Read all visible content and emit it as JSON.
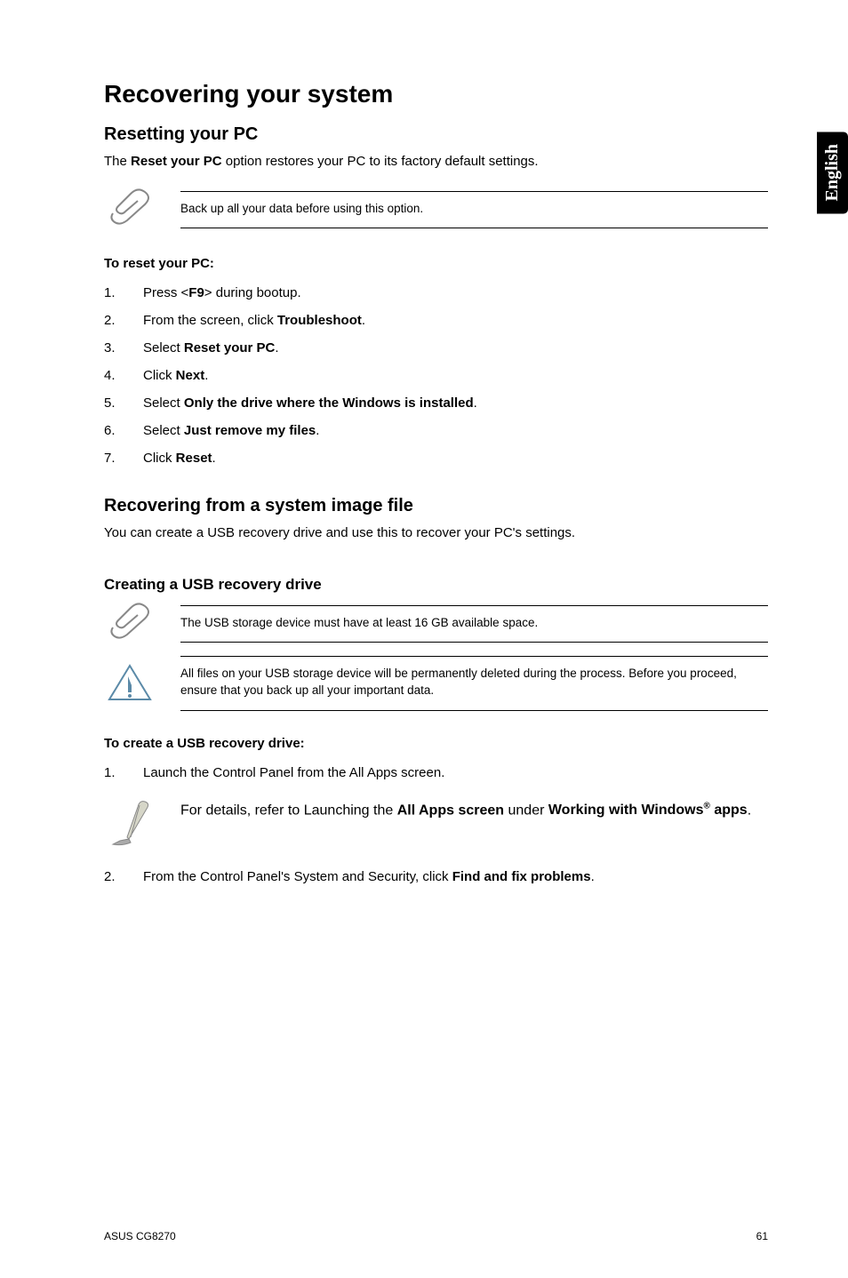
{
  "language_tab": "English",
  "h1": "Recovering your system",
  "reset": {
    "heading": "Resetting your PC",
    "intro_pre": "The ",
    "intro_bold": "Reset your PC",
    "intro_post": " option restores your PC to its factory default settings.",
    "note": "Back up all your data before using this option.",
    "steps_heading": "To reset your PC:",
    "step1_pre": "Press <",
    "step1_bold": "F9",
    "step1_post": "> during bootup.",
    "step2_pre": "From the screen, click ",
    "step2_bold": "Troubleshoot",
    "step2_post": ".",
    "step3_pre": "Select ",
    "step3_bold": "Reset your PC",
    "step3_post": ".",
    "step4_pre": "Click ",
    "step4_bold": "Next",
    "step4_post": ".",
    "step5_pre": "Select ",
    "step5_bold": "Only the drive where the Windows is installed",
    "step5_post": ".",
    "step6_pre": "Select ",
    "step6_bold": "Just remove my files",
    "step6_post": ".",
    "step7_pre": "Click ",
    "step7_bold": "Reset",
    "step7_post": "."
  },
  "recover_image": {
    "heading": "Recovering from a system image file",
    "intro": "You can create a USB recovery drive and use this to recover your PC's settings."
  },
  "usb_drive": {
    "heading": "Creating a USB recovery drive",
    "note1": "The USB storage device must have at least 16 GB available space.",
    "note2": "All files on your USB storage device will be permanently deleted during the process. Before you proceed, ensure that you back up all your important data.",
    "steps_heading": "To create a USB recovery drive:",
    "step1": "Launch the Control Panel from the All Apps screen.",
    "pen_pre": "For details, refer to Launching the ",
    "pen_bold1": "All Apps screen",
    "pen_mid": " under ",
    "pen_bold2_pre": "Working with Windows",
    "pen_bold2_sup": "®",
    "pen_bold2_post": " apps",
    "pen_post": ".",
    "step2_pre": "From the Control Panel's System and Security, click ",
    "step2_bold": "Find and fix problems",
    "step2_post": "."
  },
  "footer": {
    "left": "ASUS CG8270",
    "right": "61"
  }
}
